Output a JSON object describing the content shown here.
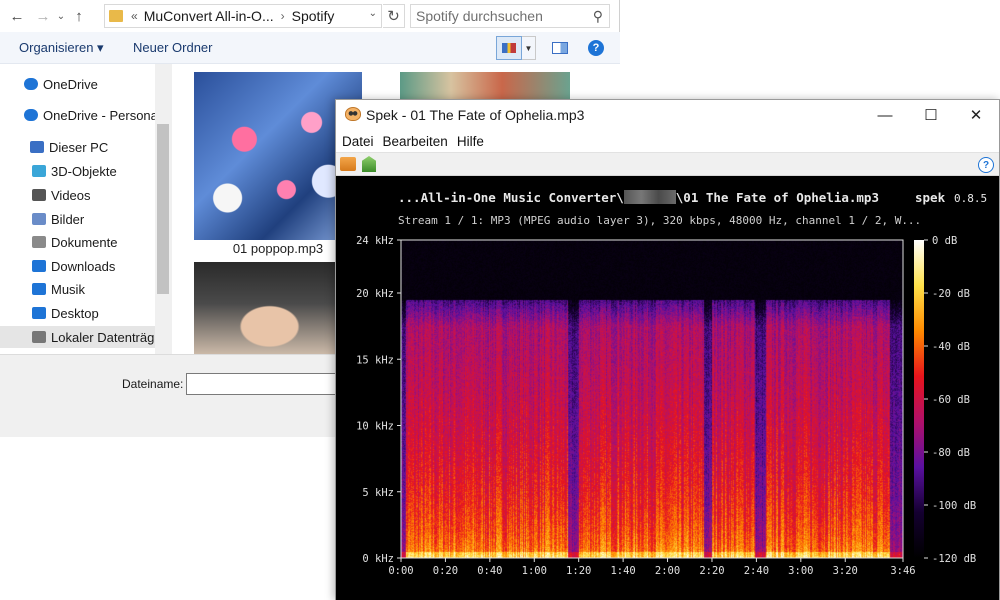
{
  "explorer": {
    "nav_buttons": {
      "back": "←",
      "forward": "→",
      "recent": "⌄",
      "up": "↑"
    },
    "address": {
      "prefix": "«",
      "segments": [
        "MuConvert All-in-O...",
        "Spotify"
      ],
      "separator": "›"
    },
    "search": {
      "placeholder": "Spotify durchsuchen"
    },
    "toolbar": {
      "organize_label": "Organisieren ▾",
      "new_folder_label": "Neuer Ordner",
      "help_label": "?"
    },
    "nav_items": [
      {
        "label": "OneDrive",
        "icon": "cloud-icon",
        "color": "#1e74d6"
      },
      {
        "label": "OneDrive - Persona",
        "icon": "cloud-icon",
        "color": "#1e74d6"
      },
      {
        "label": "Dieser PC",
        "icon": "computer-icon",
        "color": "#3a6fc4"
      },
      {
        "label": "3D-Objekte",
        "icon": "cube-icon",
        "color": "#3aa6d8"
      },
      {
        "label": "Videos",
        "icon": "film-icon",
        "color": "#555555"
      },
      {
        "label": "Bilder",
        "icon": "picture-icon",
        "color": "#6a8cc8"
      },
      {
        "label": "Dokumente",
        "icon": "document-icon",
        "color": "#8a8a8a"
      },
      {
        "label": "Downloads",
        "icon": "download-arrow-icon",
        "color": "#1e74d6"
      },
      {
        "label": "Musik",
        "icon": "music-note-icon",
        "color": "#1e74d6"
      },
      {
        "label": "Desktop",
        "icon": "desktop-icon",
        "color": "#1e74d6"
      },
      {
        "label": "Lokaler Datenträg",
        "icon": "drive-icon",
        "color": "#777777"
      }
    ],
    "files": [
      {
        "name": "01 poppop.mp3"
      }
    ],
    "footer": {
      "filename_label": "Dateiname:",
      "filename_value": ""
    }
  },
  "spek": {
    "window_title": "Spek - 01 The Fate of Ophelia.mp3",
    "controls": {
      "minimize": "—",
      "maximize": "☐",
      "close": "✕"
    },
    "menu": [
      "Datei",
      "Bearbeiten",
      "Hilfe"
    ],
    "file_label_prefix": "...All-in-One Music Converter\\",
    "file_label_suffix": "\\01 The Fate of Ophelia.mp3",
    "app_name": "spek",
    "version": "0.8.5",
    "stream_info": "Stream 1 / 1: MP3 (MPEG audio layer 3), 320 kbps, 48000 Hz, channel 1 / 2, W..."
  },
  "chart_data": {
    "type": "heatmap",
    "x_ticks": [
      "0:00",
      "0:20",
      "0:40",
      "1:00",
      "1:20",
      "1:40",
      "2:00",
      "2:20",
      "2:40",
      "3:00",
      "3:20",
      "3:46"
    ],
    "x_tick_seconds": [
      0,
      20,
      40,
      60,
      80,
      100,
      120,
      140,
      160,
      180,
      200,
      226
    ],
    "xlim_seconds": [
      0,
      226
    ],
    "y_ticks": [
      "0 kHz",
      "5 kHz",
      "10 kHz",
      "15 kHz",
      "20 kHz",
      "24 kHz"
    ],
    "y_tick_khz": [
      0,
      5,
      10,
      15,
      20,
      24
    ],
    "ylim_khz": [
      0,
      24
    ],
    "colorbar_ticks": [
      "0 dB",
      "-20 dB",
      "-40 dB",
      "-60 dB",
      "-80 dB",
      "-100 dB",
      "-120 dB"
    ],
    "colorbar_db": [
      0,
      -20,
      -40,
      -60,
      -80,
      -100,
      -120
    ],
    "colorbar_colors": [
      "#ffffff",
      "#ffe14a",
      "#ff8a00",
      "#e8141c",
      "#b0106a",
      "#5a10a0",
      "#140030",
      "#000000"
    ],
    "spectral_cutoff_khz": 19.5,
    "quiet_sections_seconds": [
      [
        0,
        2
      ],
      [
        75,
        80
      ],
      [
        136,
        140
      ],
      [
        159,
        164
      ],
      [
        220,
        226
      ]
    ]
  }
}
